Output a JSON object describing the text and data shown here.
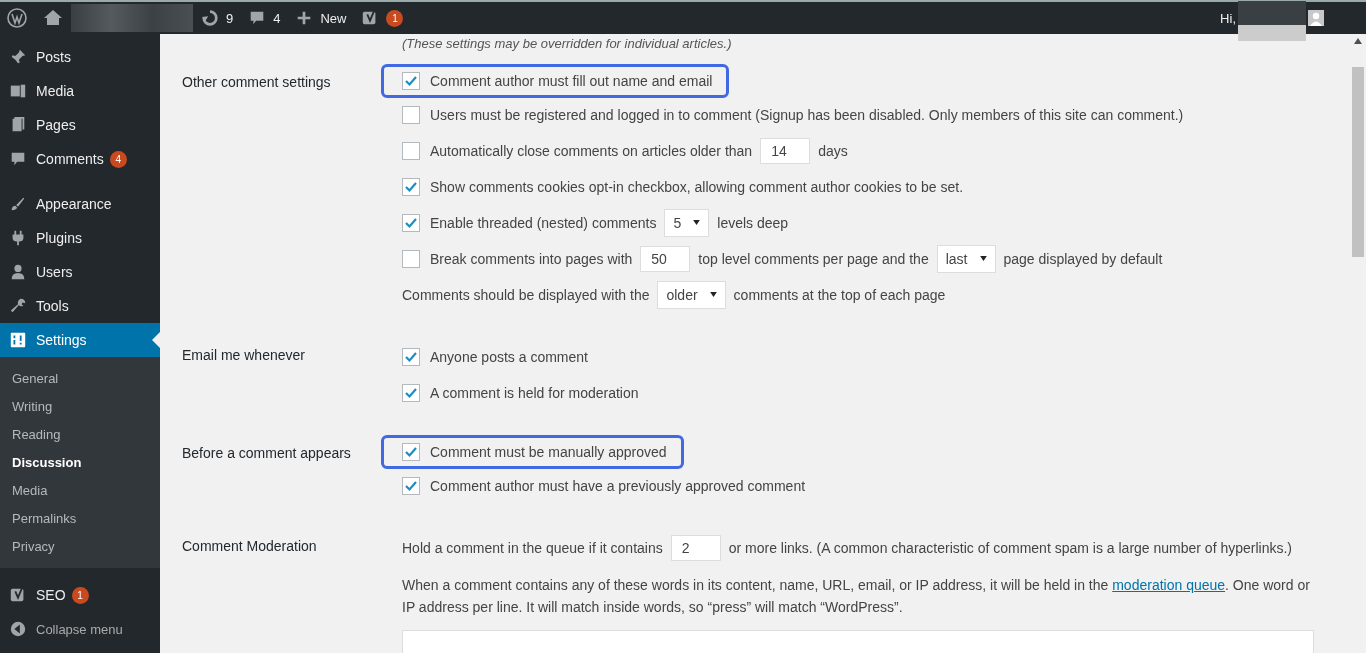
{
  "admin_bar": {
    "updates": "9",
    "comments": "4",
    "new_label": "New",
    "seo_badge": "1",
    "greeting": "Hi,"
  },
  "sidebar": {
    "groups": [
      [
        {
          "label": "Posts",
          "selected": false
        },
        {
          "label": "Media",
          "selected": false
        },
        {
          "label": "Pages",
          "selected": false
        },
        {
          "label": "Comments",
          "badge": "4",
          "selected": false
        }
      ],
      [
        {
          "label": "Appearance",
          "selected": false
        },
        {
          "label": "Plugins",
          "selected": false
        },
        {
          "label": "Users",
          "selected": false
        },
        {
          "label": "Tools",
          "selected": false
        },
        {
          "label": "Settings",
          "selected": true
        }
      ]
    ],
    "submenu": [
      {
        "label": "General",
        "selected": false
      },
      {
        "label": "Writing",
        "selected": false
      },
      {
        "label": "Reading",
        "selected": false
      },
      {
        "label": "Discussion",
        "selected": true
      },
      {
        "label": "Media",
        "selected": false
      },
      {
        "label": "Permalinks",
        "selected": false
      },
      {
        "label": "Privacy",
        "selected": false
      }
    ],
    "bottom": [
      {
        "label": "SEO",
        "badge": "1"
      },
      {
        "label": "Collapse menu"
      }
    ]
  },
  "note": "(These settings may be overridden for individual articles.)",
  "sections": [
    {
      "label": "Other comment settings",
      "rows": [
        {
          "kind": "checkbox",
          "checked": true,
          "highlighted": true,
          "parts": [
            {
              "kind": "text",
              "text": "Comment author must fill out name and email"
            }
          ]
        },
        {
          "kind": "checkbox",
          "checked": false,
          "highlighted": false,
          "parts": [
            {
              "kind": "text",
              "text": "Users must be registered and logged in to comment (Signup has been disabled. Only members of this site can comment.)"
            }
          ]
        },
        {
          "kind": "checkbox",
          "checked": false,
          "highlighted": false,
          "parts": [
            {
              "kind": "text",
              "text": "Automatically close comments on articles older than"
            },
            {
              "kind": "input",
              "value": "14"
            },
            {
              "kind": "text",
              "text": "days"
            }
          ]
        },
        {
          "kind": "checkbox",
          "checked": true,
          "highlighted": false,
          "parts": [
            {
              "kind": "text",
              "text": "Show comments cookies opt-in checkbox, allowing comment author cookies to be set."
            }
          ]
        },
        {
          "kind": "checkbox",
          "checked": true,
          "highlighted": false,
          "parts": [
            {
              "kind": "text",
              "text": "Enable threaded (nested) comments"
            },
            {
              "kind": "select",
              "value": "5"
            },
            {
              "kind": "text",
              "text": "levels deep"
            }
          ]
        },
        {
          "kind": "checkbox",
          "checked": false,
          "highlighted": false,
          "parts": [
            {
              "kind": "text",
              "text": "Break comments into pages with"
            },
            {
              "kind": "input",
              "value": "50"
            },
            {
              "kind": "text",
              "text": "top level comments per page and the"
            },
            {
              "kind": "select",
              "value": "last"
            },
            {
              "kind": "text",
              "text": "page displayed by default"
            }
          ]
        },
        {
          "kind": "plain",
          "parts": [
            {
              "kind": "text",
              "text": "Comments should be displayed with the"
            },
            {
              "kind": "select",
              "value": "older"
            },
            {
              "kind": "text",
              "text": "comments at the top of each page"
            }
          ]
        }
      ]
    },
    {
      "label": "Email me whenever",
      "rows": [
        {
          "kind": "checkbox",
          "checked": true,
          "highlighted": false,
          "parts": [
            {
              "kind": "text",
              "text": "Anyone posts a comment"
            }
          ]
        },
        {
          "kind": "checkbox",
          "checked": true,
          "highlighted": false,
          "parts": [
            {
              "kind": "text",
              "text": "A comment is held for moderation"
            }
          ]
        }
      ]
    },
    {
      "label": "Before a comment appears",
      "rows": [
        {
          "kind": "checkbox",
          "checked": true,
          "highlighted": true,
          "parts": [
            {
              "kind": "text",
              "text": "Comment must be manually approved"
            }
          ]
        },
        {
          "kind": "checkbox",
          "checked": true,
          "highlighted": false,
          "parts": [
            {
              "kind": "text",
              "text": "Comment author must have a previously approved comment"
            }
          ]
        }
      ]
    },
    {
      "label": "Comment Moderation",
      "rows": [
        {
          "kind": "plain",
          "parts": [
            {
              "kind": "text",
              "text": "Hold a comment in the queue if it contains"
            },
            {
              "kind": "input",
              "value": "2"
            },
            {
              "kind": "text",
              "text": "or more links. (A common characteristic of comment spam is a large number of hyperlinks.)"
            }
          ]
        },
        {
          "kind": "paragraph",
          "before": "When a comment contains any of these words in its content, name, URL, email, or IP address, it will be held in the",
          "link": "moderation queue",
          "after": ". One word or IP address per line. It will match inside words, so “press” will match “WordPress”."
        },
        {
          "kind": "textarea"
        }
      ]
    }
  ]
}
